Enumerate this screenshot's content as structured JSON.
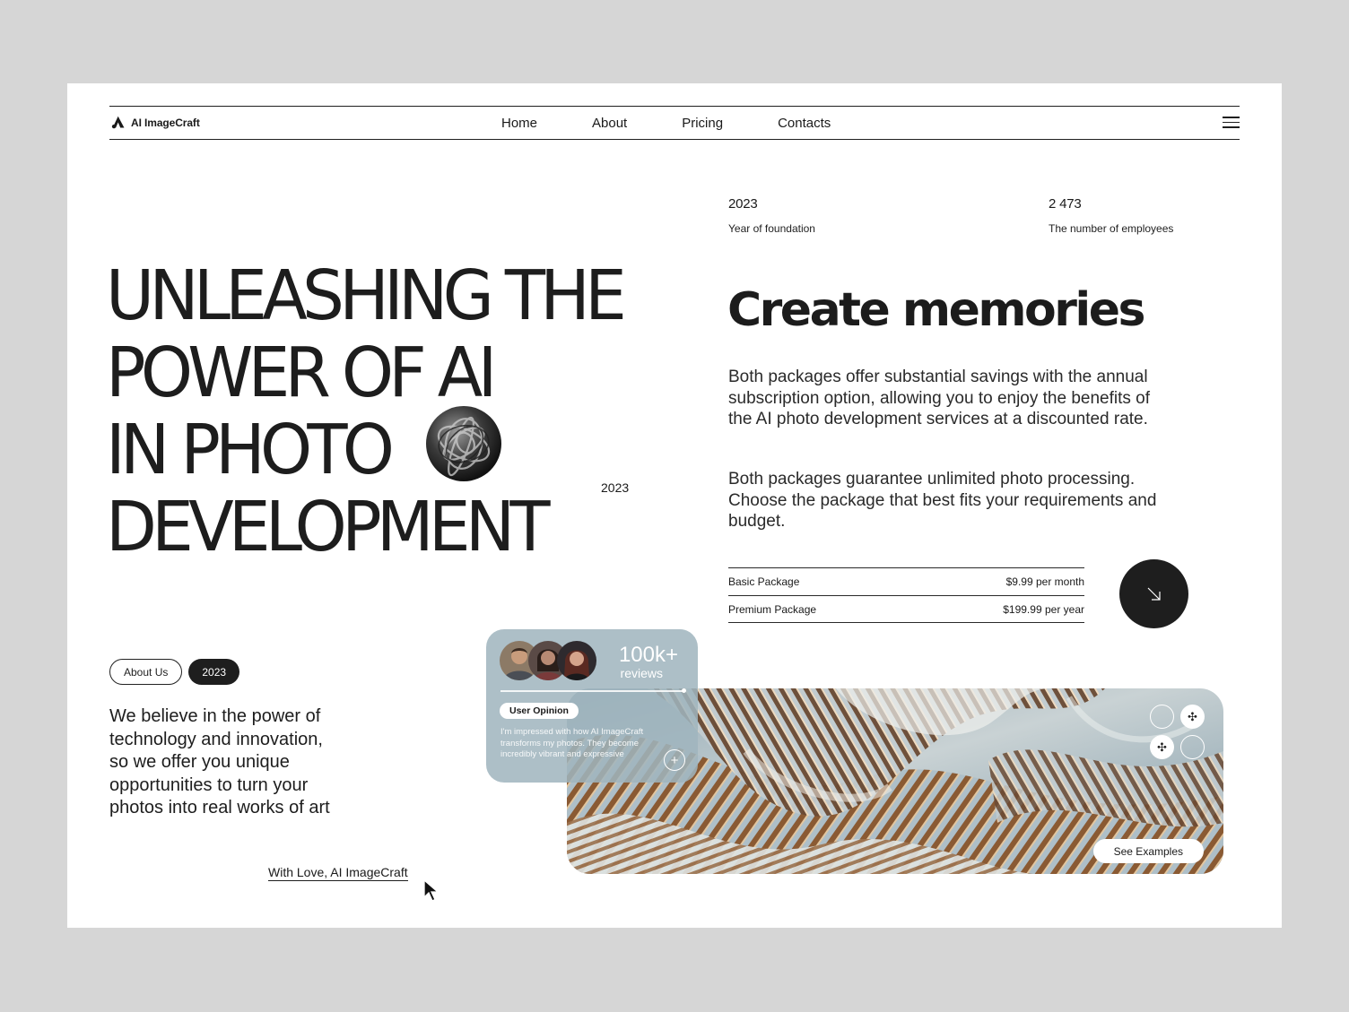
{
  "nav": {
    "brand": "AI ImageCraft",
    "links": [
      "Home",
      "About",
      "Pricing",
      "Contacts"
    ]
  },
  "hero": {
    "lines": [
      "UNLEASHING THE",
      "POWER OF AI",
      "IN PHOTO",
      "DEVELOPMENT"
    ],
    "year": "2023"
  },
  "stats": [
    {
      "value": "2023",
      "label": "Year of foundation"
    },
    {
      "value": "2 473",
      "label": "The number of employees"
    }
  ],
  "headline": "Create memories",
  "paragraphs": [
    "Both packages offer substantial savings with the annual subscription option, allowing you to enjoy the benefits of the AI photo development services at a discounted rate.",
    "Both packages guarantee unlimited photo processing. Choose the package that best fits your requirements and budget."
  ],
  "packages": [
    {
      "name": "Basic Package",
      "price": "$9.99",
      "period": "per month"
    },
    {
      "name": "Premium Package",
      "price": "$199.99",
      "period": "per year"
    }
  ],
  "about": {
    "pill_label": "About Us",
    "pill_year": "2023",
    "text": "We believe in the power of technology and innovation, so we offer you unique opportunities to turn your photos into real works of art",
    "signature": "With Love, AI ImageCraft"
  },
  "review": {
    "count": "100k+",
    "label": "reviews",
    "tag": "User Opinion",
    "quote": "I'm impressed with how AI ImageCraft transforms my photos. They become incredibly vibrant and expressive"
  },
  "gallery": {
    "button": "See Examples"
  }
}
